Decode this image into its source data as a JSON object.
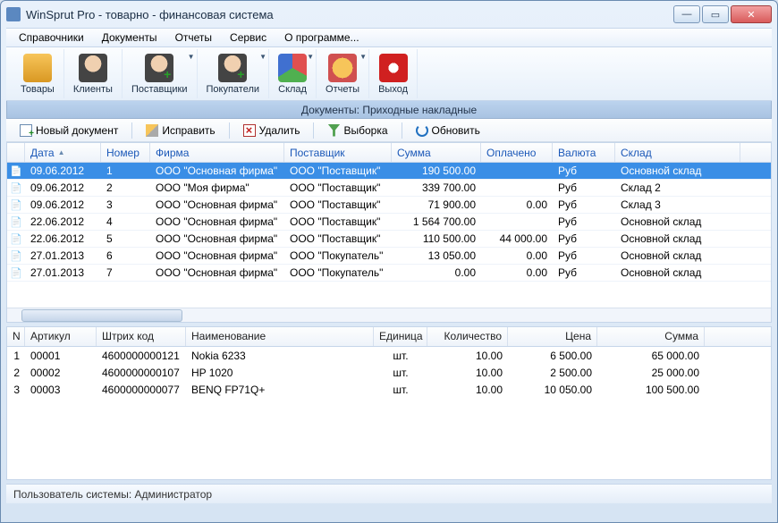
{
  "window": {
    "title": "WinSprut Pro - товарно - финансовая система"
  },
  "menubar": [
    "Справочники",
    "Документы",
    "Отчеты",
    "Сервис",
    "О программе..."
  ],
  "toolbar": [
    {
      "key": "goods",
      "label": "Товары",
      "drop": false
    },
    {
      "key": "clients",
      "label": "Клиенты",
      "drop": false
    },
    {
      "key": "suppliers",
      "label": "Поставщики",
      "drop": true
    },
    {
      "key": "buyers",
      "label": "Покупатели",
      "drop": true
    },
    {
      "key": "warehouse",
      "label": "Склад",
      "drop": true
    },
    {
      "key": "reports",
      "label": "Отчеты",
      "drop": true
    },
    {
      "key": "exit",
      "label": "Выход",
      "drop": false
    }
  ],
  "subheader": "Документы: Приходные накладные",
  "actionbar": {
    "newdoc": "Новый документ",
    "edit": "Исправить",
    "delete": "Удалить",
    "filter": "Выборка",
    "refresh": "Обновить"
  },
  "grid": {
    "headers": [
      "Дата",
      "Номер",
      "Фирма",
      "Поставщик",
      "Сумма",
      "Оплачено",
      "Валюта",
      "Склад"
    ],
    "widths": [
      85,
      55,
      150,
      120,
      100,
      80,
      70,
      140
    ],
    "rows": [
      {
        "sel": true,
        "date": "09.06.2012",
        "num": "1",
        "firm": "ООО \"Основная фирма\"",
        "supplier": "ООО \"Поставщик\"",
        "sum": "190 500.00",
        "paid": "",
        "cur": "Руб",
        "wh": "Основной склад"
      },
      {
        "sel": false,
        "date": "09.06.2012",
        "num": "2",
        "firm": "ООО \"Моя фирма\"",
        "supplier": "ООО \"Поставщик\"",
        "sum": "339 700.00",
        "paid": "",
        "cur": "Руб",
        "wh": "Склад 2"
      },
      {
        "sel": false,
        "date": "09.06.2012",
        "num": "3",
        "firm": "ООО \"Основная фирма\"",
        "supplier": "ООО \"Поставщик\"",
        "sum": "71 900.00",
        "paid": "0.00",
        "cur": "Руб",
        "wh": "Склад 3"
      },
      {
        "sel": false,
        "date": "22.06.2012",
        "num": "4",
        "firm": "ООО \"Основная фирма\"",
        "supplier": "ООО \"Поставщик\"",
        "sum": "1 564 700.00",
        "paid": "",
        "cur": "Руб",
        "wh": "Основной склад"
      },
      {
        "sel": false,
        "date": "22.06.2012",
        "num": "5",
        "firm": "ООО \"Основная фирма\"",
        "supplier": "ООО \"Поставщик\"",
        "sum": "110 500.00",
        "paid": "44 000.00",
        "cur": "Руб",
        "wh": "Основной склад"
      },
      {
        "sel": false,
        "date": "27.01.2013",
        "num": "6",
        "firm": "ООО \"Основная фирма\"",
        "supplier": "ООО \"Покупатель\"",
        "sum": "13 050.00",
        "paid": "0.00",
        "cur": "Руб",
        "wh": "Основной склад"
      },
      {
        "sel": false,
        "date": "27.01.2013",
        "num": "7",
        "firm": "ООО \"Основная фирма\"",
        "supplier": "ООО \"Покупатель\"",
        "sum": "0.00",
        "paid": "0.00",
        "cur": "Руб",
        "wh": "Основной склад"
      }
    ]
  },
  "detail": {
    "headers": [
      "N",
      "Артикул",
      "Штрих код",
      "Наименование",
      "Единица",
      "Количество",
      "Цена",
      "Сумма"
    ],
    "widths": [
      20,
      80,
      100,
      210,
      60,
      90,
      100,
      120
    ],
    "rows": [
      {
        "n": "1",
        "art": "00001",
        "bc": "4600000000121",
        "name": "Nokia 6233",
        "unit": "шт.",
        "qty": "10.00",
        "price": "6 500.00",
        "sum": "65 000.00"
      },
      {
        "n": "2",
        "art": "00002",
        "bc": "4600000000107",
        "name": "HP 1020",
        "unit": "шт.",
        "qty": "10.00",
        "price": "2 500.00",
        "sum": "25 000.00"
      },
      {
        "n": "3",
        "art": "00003",
        "bc": "4600000000077",
        "name": "BENQ FP71Q+",
        "unit": "шт.",
        "qty": "10.00",
        "price": "10 050.00",
        "sum": "100 500.00"
      }
    ]
  },
  "statusbar": "Пользователь системы: Администратор"
}
